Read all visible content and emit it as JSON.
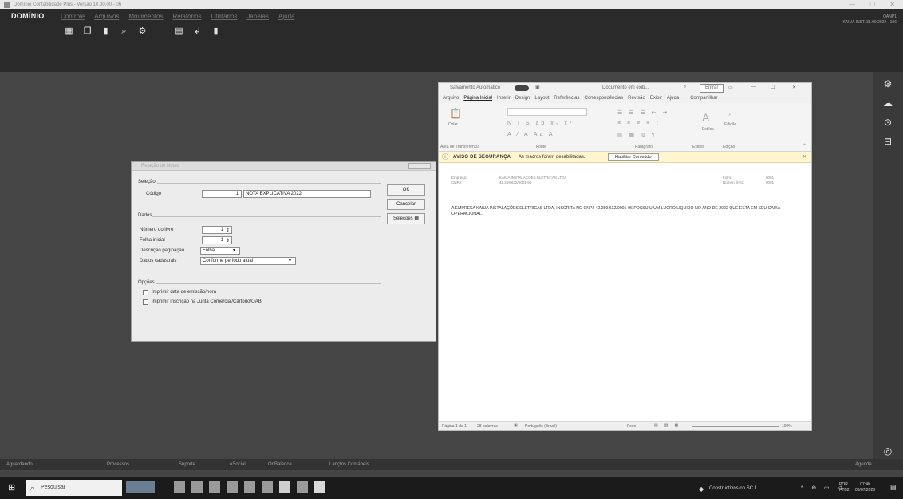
{
  "window": {
    "title": "Domínio Contabilidade Plus - Versão 10.30.00 - 06",
    "min": "—",
    "max": "☐",
    "close": "✕"
  },
  "app": {
    "brand": "DOMÍNIO",
    "menu": [
      "Controle",
      "Arquivos",
      "Movimentos",
      "Relatórios",
      "Utilitários",
      "Janelas",
      "Ajuda"
    ],
    "toolbar_icons": [
      "grid-icon",
      "copy-icon",
      "document-icon",
      "search-icon",
      "gear-icon",
      "blank-icon",
      "calculator-icon",
      "arrow-icon",
      "bookmark-icon"
    ],
    "company_line1": "OANP1",
    "company_line2": "KAIUA INST. 31.09.2022 - 196"
  },
  "dialog": {
    "title": "Relação de Notas",
    "section_selection": "Seleção",
    "codigo_label": "Código",
    "codigo_number": "1",
    "codigo_value": "NOTA EXPLICATIVA 2022",
    "section_dados": "Dados",
    "numero_livro_label": "Número do livro",
    "numero_livro_value": "1",
    "folha_inicial_label": "Folha inicial",
    "folha_inicial_value": "1",
    "descricao_label": "Descrição paginação",
    "descricao_value": "Folha",
    "dados_cadastrais_label": "Dados cadastrais",
    "dados_cadastrais_value": "Conforme período atual",
    "section_opcoes": "Opções",
    "option1": "Imprimir data de emissão/hora",
    "option2": "Imprimir inscrição na Junta Comercial/Cartório/OAB",
    "ok_label": "OK",
    "cancel_label": "Cancelar",
    "options_label": "Seleções"
  },
  "word": {
    "autosave": "Salvamento Automático",
    "autosave_state": "",
    "doc_name": "Documento em exib...",
    "search_glyph": "⌕",
    "login": "Entrar",
    "tabs": [
      "Arquivo",
      "Página Inicial",
      "Inserir",
      "Design",
      "Layout",
      "Referências",
      "Correspondências",
      "Revisão",
      "Exibir",
      "Ajuda"
    ],
    "share": "Compartilhar",
    "ribbon_groups": [
      "Área de Transferência",
      "Fonte",
      "Parágrafo",
      "Estilos",
      "Edição"
    ],
    "paste": "Colar",
    "styles": "Estilos",
    "edit": "Edição",
    "alert_title": "AVISO DE SEGURANÇA",
    "alert_text": "As macros foram desabilitadas.",
    "alert_button": "Habilitar Conteúdo",
    "doc_header_left1": "Empresa:",
    "doc_header_left2": "CNPJ:",
    "doc_header_mid1": "KAIUA INSTALACOES ELETRICAS LTDA",
    "doc_header_mid2": "42.259.632/0001-96",
    "doc_header_right1": "Folha:",
    "doc_header_right2": "Número livro:",
    "doc_header_val1": "0001",
    "doc_header_val2": "0001",
    "body_text": "A EMPRESA KAIUA INSTALAÇÕES ELETRICAS LTDA, INSCRITA NO CNPJ 42.259.632/0001-96 POSSUIU UM LUCRO LIQUIDO NO ANO DE 2022 QUE ESTA EM SEU CAIXA OPERACIONAL.",
    "status_page": "Página 1 de 1",
    "status_words": "28 palavras",
    "status_lang": "Português (Brasil)",
    "status_focus": "Foco",
    "status_zoom": "100%"
  },
  "status_bar": {
    "items": [
      "Aguardando",
      "Processos",
      "Suporte",
      "eSocial",
      "OnBalance",
      "Lançtos Contábeis"
    ],
    "right": "Agenda"
  },
  "taskbar": {
    "search_placeholder": "Pesquisar",
    "weather": "Constructions on SC 1...",
    "lang1": "POR",
    "lang2": "PTB2",
    "time": "07:40",
    "date": "06/07/2023"
  }
}
